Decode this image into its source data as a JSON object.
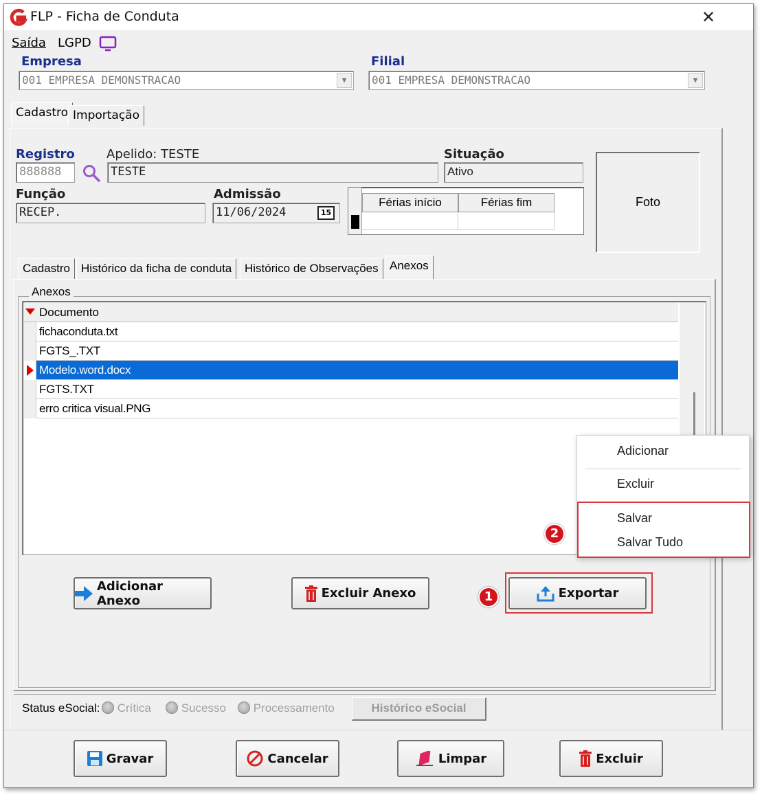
{
  "window": {
    "title": "FLP - Ficha de Conduta",
    "close_glyph": "✕"
  },
  "menubar": {
    "items": [
      {
        "label": "Saída",
        "accel": "S"
      },
      {
        "label": "LGPD",
        "accel": "L"
      }
    ]
  },
  "empresa": {
    "label": "Empresa",
    "value": "001 EMPRESA DEMONSTRACAO"
  },
  "filial": {
    "label": "Filial",
    "value": "001 EMPRESA DEMONSTRACAO"
  },
  "top_tabs": [
    "Cadastro",
    "Importação"
  ],
  "employee": {
    "registro_label": "Registro",
    "registro_value": "888888",
    "apelido_label": "Apelido: TESTE",
    "apelido_value": "TESTE",
    "situacao_label": "Situação",
    "situacao_value": "Ativo",
    "funcao_label": "Função",
    "funcao_value": "RECEP.",
    "admissao_label": "Admissão",
    "admissao_value": "11/06/2024",
    "calendar_day": "15",
    "ferias_inicio": "Férias início",
    "ferias_fim": "Férias fim",
    "foto": "Foto"
  },
  "inner_tabs": [
    "Cadastro",
    "Histórico da ficha de conduta",
    "Histórico de Observações",
    "Anexos"
  ],
  "anexos": {
    "group_label": "Anexos",
    "column_header": "Documento",
    "rows": [
      {
        "name": "fichaconduta.txt",
        "selected": false
      },
      {
        "name": "FGTS_.TXT",
        "selected": false
      },
      {
        "name": "Modelo.word.docx",
        "selected": true
      },
      {
        "name": "FGTS.TXT",
        "selected": false
      },
      {
        "name": "erro critica visual.PNG",
        "selected": false
      }
    ]
  },
  "context_menu": {
    "items": [
      "Adicionar",
      "Excluir",
      "Salvar",
      "Salvar Tudo"
    ]
  },
  "annotations": {
    "step1": "1",
    "step2": "2"
  },
  "anexo_buttons": {
    "adicionar": "Adicionar Anexo",
    "excluir": "Excluir Anexo",
    "exportar": "Exportar"
  },
  "esocial": {
    "label": "Status eSocial:",
    "critica": "Crítica",
    "sucesso": "Sucesso",
    "processamento": "Processamento",
    "historico": "Histórico eSocial"
  },
  "footer_buttons": {
    "gravar": "Gravar",
    "cancelar": "Cancelar",
    "limpar": "Limpar",
    "excluir": "Excluir"
  },
  "colors": {
    "accent_blue": "#1a2f8f",
    "selection": "#0a6ad6",
    "highlight_red": "#d9363e"
  }
}
